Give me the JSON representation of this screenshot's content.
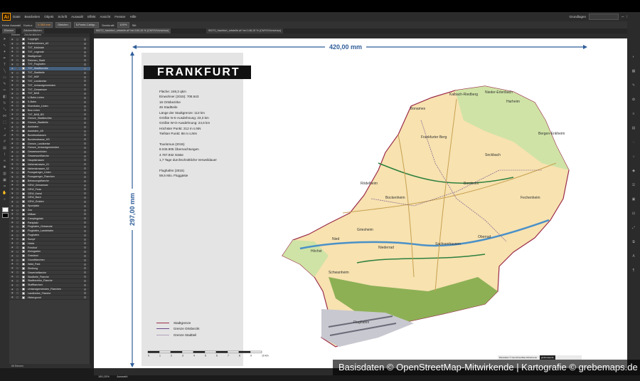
{
  "app": {
    "logo": "Ai",
    "menu": [
      "Datei",
      "Bearbeiten",
      "Objekt",
      "Schrift",
      "Auswahl",
      "Effekt",
      "Ansicht",
      "Fenster",
      "Hilfe"
    ],
    "workspace": "Grundlagen"
  },
  "control_bar": {
    "label": "Keine Auswahl",
    "stroke_label": "Kontur:",
    "stroke_value": "0,353 mm",
    "style_label": "Gleichm.",
    "brush": "5-Punkt-Calligr...",
    "opacity_label": "Deckkraft:",
    "opacity_value": "100%",
    "style2": "Stil:"
  },
  "tabs": [
    "Ebenen",
    "Zeichenflächen",
    "50072_frankfurt_ortsteile.ai* bei 160,15 % (CMYK/Vorschau)",
    "50070_frankfurt_ortsteile.ai* bei 148,15 % (CMYK/Vorschau)"
  ],
  "document_tab": "50072_frankfurt_ortsteile.ai* bei 160,15 % (CMYK/Vorschau)",
  "layers_panel": {
    "headers": [
      "Ebenen",
      "Zeichenflächen"
    ],
    "footer": "65 Ebenen",
    "selected_index": 7,
    "items": [
      "Copyright",
      "Kartenrahmen_A3",
      "TXT_Maßstab",
      "TXT_Legende",
      "Stadtgrenze",
      "Rahmen_Stadt",
      "TXT_Flughafen",
      "TXT_Stadtbezirke",
      "TXT_Stadtteile",
      "TXT_HBF",
      "TXT_Landkreise",
      "TXT_Umlandgemeinden",
      "TXT_Gewaesser",
      "TXT_BAB",
      "U-Bahn-Linien",
      "S-Bahn",
      "Eisenbahn_Linien",
      "Bus-Linien",
      "TXT_BAB_BS",
      "Grenze_Stadtbezirke",
      "Grenze_Stadtteile",
      "Autobahn",
      "Autobahn_AS",
      "Bundesstrassen",
      "Bundesstrasse_HS",
      "Grenze_Landkreise",
      "Grenze_Umlandgemeinden",
      "Gewaesserlinien",
      "Gewaesserflaeche",
      "Hauptstrassen",
      "Nebenstrassen_01",
      "Nebenstrassen_02",
      "Fussgaenger_Linien",
      "Fussgaenger_Flaechen",
      "Bebauungsflaeche",
      "GEW_Gewaesser",
      "GEW_Fluss",
      "GEW_Kanal",
      "GEW_Bach",
      "GEW_Graben",
      "Sportplatz",
      "Zoo",
      "Militaer",
      "Campingplatz",
      "Parkplatz",
      "Flughafen_Gebaeude",
      "Flughafen_Landebahn",
      "Flughafen",
      "Sumpf",
      "Heide",
      "Friedhof",
      "Kleingarten",
      "Grasland",
      "Grundflaechen",
      "Wald_Park",
      "Siedlung",
      "Gewerbeflaeche",
      "Stadtteile_Flaeche",
      "Stadtbezirke_Flaeche",
      "Stoffflaechen",
      "Umlandgemeinden_Flaechen",
      "Landkreise_Flaeche",
      "Hintergrund"
    ]
  },
  "map": {
    "title": "FRANKFURT",
    "dim_width": "420,00 mm",
    "dim_height": "297,00 mm",
    "stats": [
      "Fläche: 248,3 qkm",
      "Einwohner (2015): 708.543",
      "16 Ortsbezirke",
      "46 Stadtteile",
      "Länge der Stadtgrenze: 113 km",
      "Größte N-S-Ausdehnung: 23,3 km",
      "Größte W-O-Ausdehnung: 24,6 km",
      "Höchster Punkt: 212 m ü.NN",
      "Tiefster Punkt: 88 m ü.NN",
      "",
      "Tourismus (2015)",
      "8.045.905 Übernachtungen",
      "4.787.932 Gäste",
      "1,7 Tage durchschnittliche Verweildauer",
      "",
      "Flughafen (2015)",
      "59,5 Mio. Fluggäste"
    ],
    "legend": [
      {
        "label": "Stadtgrenze",
        "color": "#9b2c4a"
      },
      {
        "label": "Grenze Ortsbezirk",
        "color": "#6b4a8a"
      },
      {
        "label": "Grenze Stadtteil",
        "color": "#b0a0b8"
      }
    ],
    "scale_labels": [
      "0",
      "1",
      "2",
      "3",
      "4",
      "5",
      "6",
      "7",
      "8",
      "9",
      "10 km"
    ],
    "credit_small": "Basisdaten © OpenStreetMap-Mitwirkende",
    "credit_small_brand": "grebemaps.de",
    "district_labels": [
      "Bonames",
      "Kalbach-Riedberg",
      "Nieder-Erlenbach",
      "Harheim",
      "Bergen-Enkheim",
      "Seckbach",
      "Bornheim",
      "Fechenheim",
      "Sachsenhausen",
      "Höchst",
      "Nied",
      "Griesheim",
      "Bockenheim",
      "Rödelheim",
      "Niederrad",
      "Schwanheim",
      "Oberrad",
      "Frankfurter Berg",
      "Flughafen"
    ]
  },
  "status": {
    "zoom": "160,15%",
    "tool": "Auswahl"
  },
  "watermark": "Basisdaten © OpenStreetMap-Mitwirkende | Kartografie © grebemaps.de",
  "colors": {
    "dimension": "#2f5d99",
    "city_boundary": "#9b2c4a",
    "forest": "#8db055",
    "settlement": "#f6dca0",
    "green": "#cfe3a6"
  }
}
